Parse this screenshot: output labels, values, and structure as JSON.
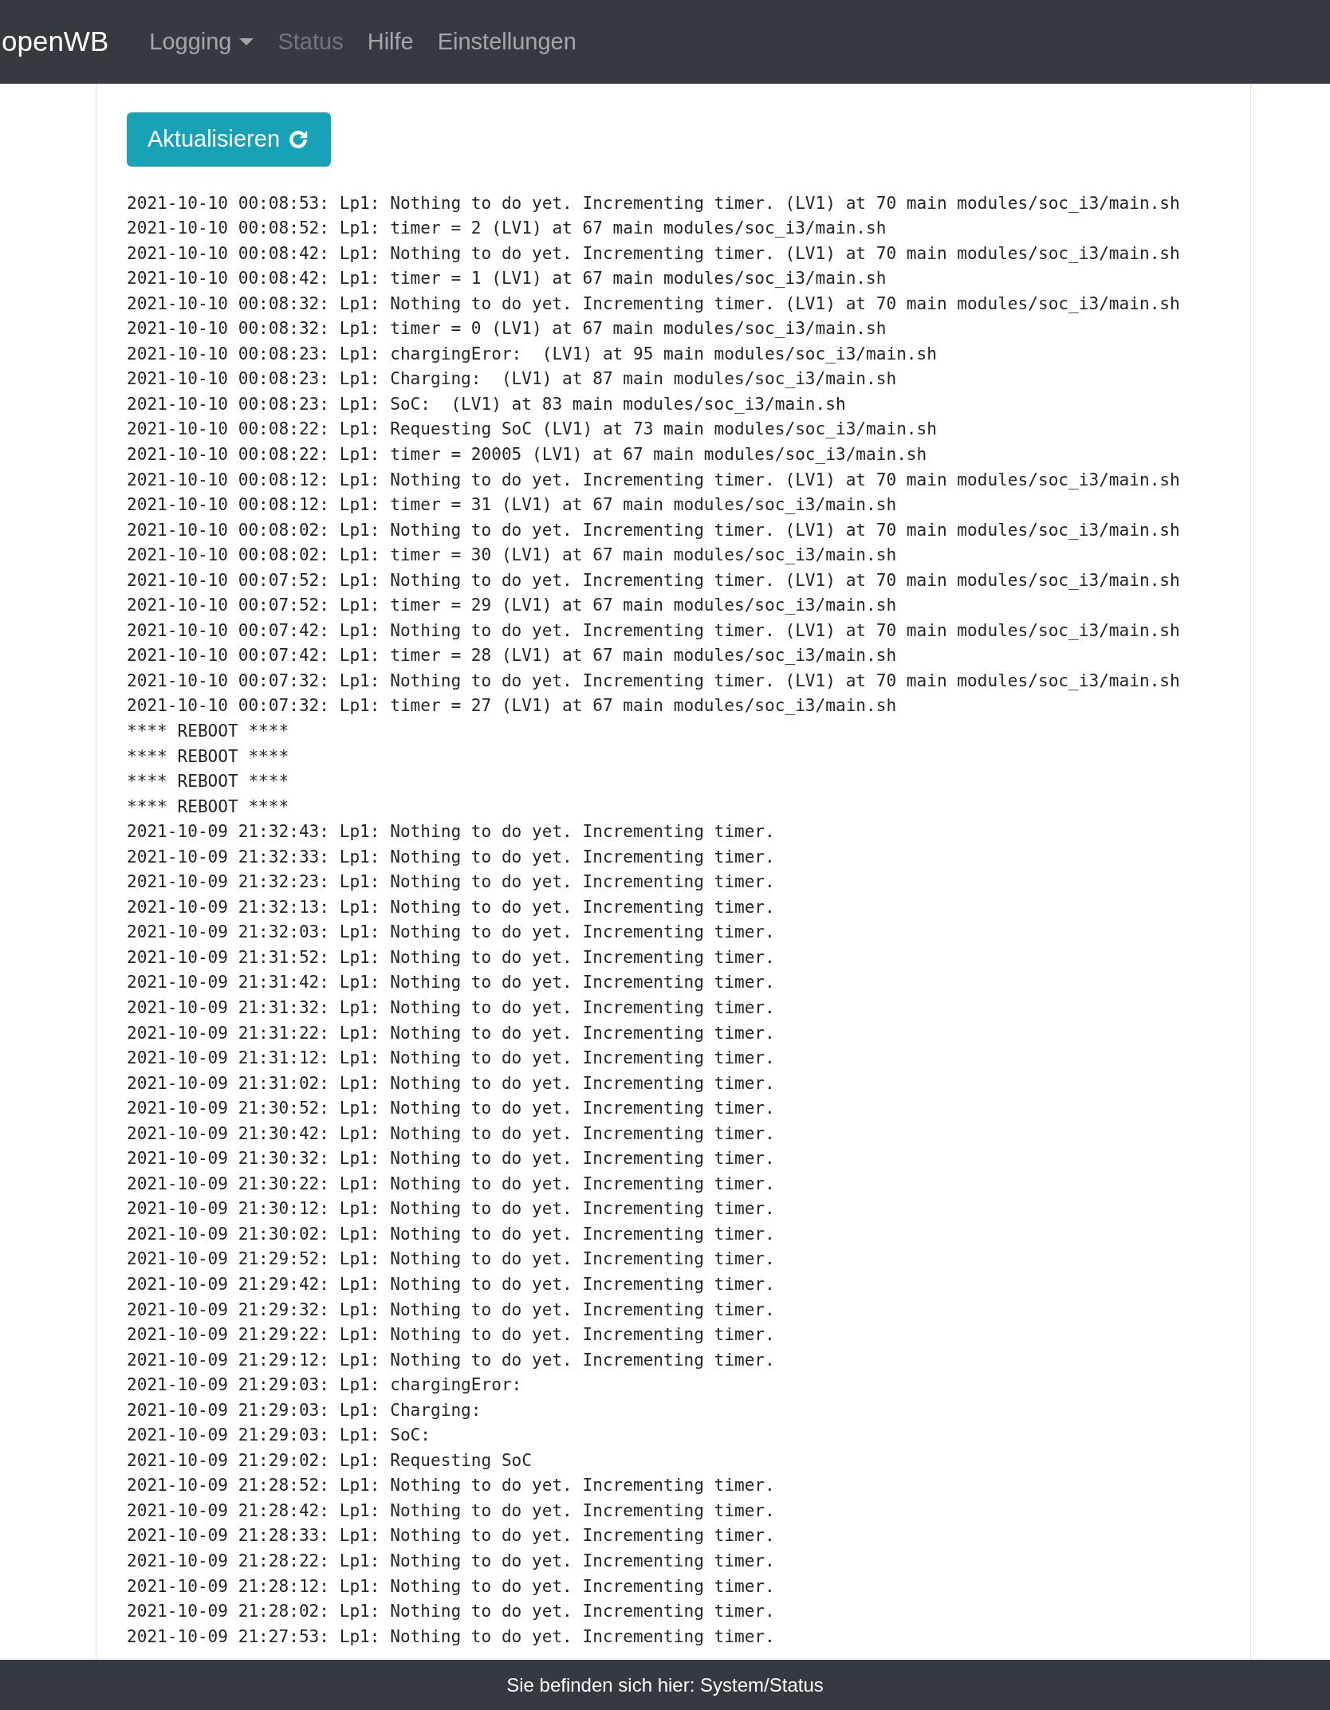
{
  "navbar": {
    "brand": "openWB",
    "items": [
      {
        "label": "Logging",
        "kind": "dropdown",
        "disabled": false
      },
      {
        "label": "Status",
        "kind": "link",
        "disabled": true
      },
      {
        "label": "Hilfe",
        "kind": "link",
        "disabled": false
      },
      {
        "label": "Einstellungen",
        "kind": "link",
        "disabled": false
      }
    ]
  },
  "refresh_button": {
    "label": "Aktualisieren"
  },
  "log_lines": [
    "2021-10-10 00:08:53: Lp1: Nothing to do yet. Incrementing timer. (LV1) at 70 main modules/soc_i3/main.sh",
    "2021-10-10 00:08:52: Lp1: timer = 2 (LV1) at 67 main modules/soc_i3/main.sh",
    "2021-10-10 00:08:42: Lp1: Nothing to do yet. Incrementing timer. (LV1) at 70 main modules/soc_i3/main.sh",
    "2021-10-10 00:08:42: Lp1: timer = 1 (LV1) at 67 main modules/soc_i3/main.sh",
    "2021-10-10 00:08:32: Lp1: Nothing to do yet. Incrementing timer. (LV1) at 70 main modules/soc_i3/main.sh",
    "2021-10-10 00:08:32: Lp1: timer = 0 (LV1) at 67 main modules/soc_i3/main.sh",
    "2021-10-10 00:08:23: Lp1: chargingEror:  (LV1) at 95 main modules/soc_i3/main.sh",
    "2021-10-10 00:08:23: Lp1: Charging:  (LV1) at 87 main modules/soc_i3/main.sh",
    "2021-10-10 00:08:23: Lp1: SoC:  (LV1) at 83 main modules/soc_i3/main.sh",
    "2021-10-10 00:08:22: Lp1: Requesting SoC (LV1) at 73 main modules/soc_i3/main.sh",
    "2021-10-10 00:08:22: Lp1: timer = 20005 (LV1) at 67 main modules/soc_i3/main.sh",
    "2021-10-10 00:08:12: Lp1: Nothing to do yet. Incrementing timer. (LV1) at 70 main modules/soc_i3/main.sh",
    "2021-10-10 00:08:12: Lp1: timer = 31 (LV1) at 67 main modules/soc_i3/main.sh",
    "2021-10-10 00:08:02: Lp1: Nothing to do yet. Incrementing timer. (LV1) at 70 main modules/soc_i3/main.sh",
    "2021-10-10 00:08:02: Lp1: timer = 30 (LV1) at 67 main modules/soc_i3/main.sh",
    "2021-10-10 00:07:52: Lp1: Nothing to do yet. Incrementing timer. (LV1) at 70 main modules/soc_i3/main.sh",
    "2021-10-10 00:07:52: Lp1: timer = 29 (LV1) at 67 main modules/soc_i3/main.sh",
    "2021-10-10 00:07:42: Lp1: Nothing to do yet. Incrementing timer. (LV1) at 70 main modules/soc_i3/main.sh",
    "2021-10-10 00:07:42: Lp1: timer = 28 (LV1) at 67 main modules/soc_i3/main.sh",
    "2021-10-10 00:07:32: Lp1: Nothing to do yet. Incrementing timer. (LV1) at 70 main modules/soc_i3/main.sh",
    "2021-10-10 00:07:32: Lp1: timer = 27 (LV1) at 67 main modules/soc_i3/main.sh",
    "**** REBOOT ****",
    "**** REBOOT ****",
    "**** REBOOT ****",
    "**** REBOOT ****",
    "2021-10-09 21:32:43: Lp1: Nothing to do yet. Incrementing timer.",
    "2021-10-09 21:32:33: Lp1: Nothing to do yet. Incrementing timer.",
    "2021-10-09 21:32:23: Lp1: Nothing to do yet. Incrementing timer.",
    "2021-10-09 21:32:13: Lp1: Nothing to do yet. Incrementing timer.",
    "2021-10-09 21:32:03: Lp1: Nothing to do yet. Incrementing timer.",
    "2021-10-09 21:31:52: Lp1: Nothing to do yet. Incrementing timer.",
    "2021-10-09 21:31:42: Lp1: Nothing to do yet. Incrementing timer.",
    "2021-10-09 21:31:32: Lp1: Nothing to do yet. Incrementing timer.",
    "2021-10-09 21:31:22: Lp1: Nothing to do yet. Incrementing timer.",
    "2021-10-09 21:31:12: Lp1: Nothing to do yet. Incrementing timer.",
    "2021-10-09 21:31:02: Lp1: Nothing to do yet. Incrementing timer.",
    "2021-10-09 21:30:52: Lp1: Nothing to do yet. Incrementing timer.",
    "2021-10-09 21:30:42: Lp1: Nothing to do yet. Incrementing timer.",
    "2021-10-09 21:30:32: Lp1: Nothing to do yet. Incrementing timer.",
    "2021-10-09 21:30:22: Lp1: Nothing to do yet. Incrementing timer.",
    "2021-10-09 21:30:12: Lp1: Nothing to do yet. Incrementing timer.",
    "2021-10-09 21:30:02: Lp1: Nothing to do yet. Incrementing timer.",
    "2021-10-09 21:29:52: Lp1: Nothing to do yet. Incrementing timer.",
    "2021-10-09 21:29:42: Lp1: Nothing to do yet. Incrementing timer.",
    "2021-10-09 21:29:32: Lp1: Nothing to do yet. Incrementing timer.",
    "2021-10-09 21:29:22: Lp1: Nothing to do yet. Incrementing timer.",
    "2021-10-09 21:29:12: Lp1: Nothing to do yet. Incrementing timer.",
    "2021-10-09 21:29:03: Lp1: chargingEror:",
    "2021-10-09 21:29:03: Lp1: Charging:",
    "2021-10-09 21:29:03: Lp1: SoC:",
    "2021-10-09 21:29:02: Lp1: Requesting SoC",
    "2021-10-09 21:28:52: Lp1: Nothing to do yet. Incrementing timer.",
    "2021-10-09 21:28:42: Lp1: Nothing to do yet. Incrementing timer.",
    "2021-10-09 21:28:33: Lp1: Nothing to do yet. Incrementing timer.",
    "2021-10-09 21:28:22: Lp1: Nothing to do yet. Incrementing timer.",
    "2021-10-09 21:28:12: Lp1: Nothing to do yet. Incrementing timer.",
    "2021-10-09 21:28:02: Lp1: Nothing to do yet. Incrementing timer.",
    "2021-10-09 21:27:53: Lp1: Nothing to do yet. Incrementing timer."
  ],
  "footer": {
    "text": "Sie befinden sich hier: System/Status"
  }
}
